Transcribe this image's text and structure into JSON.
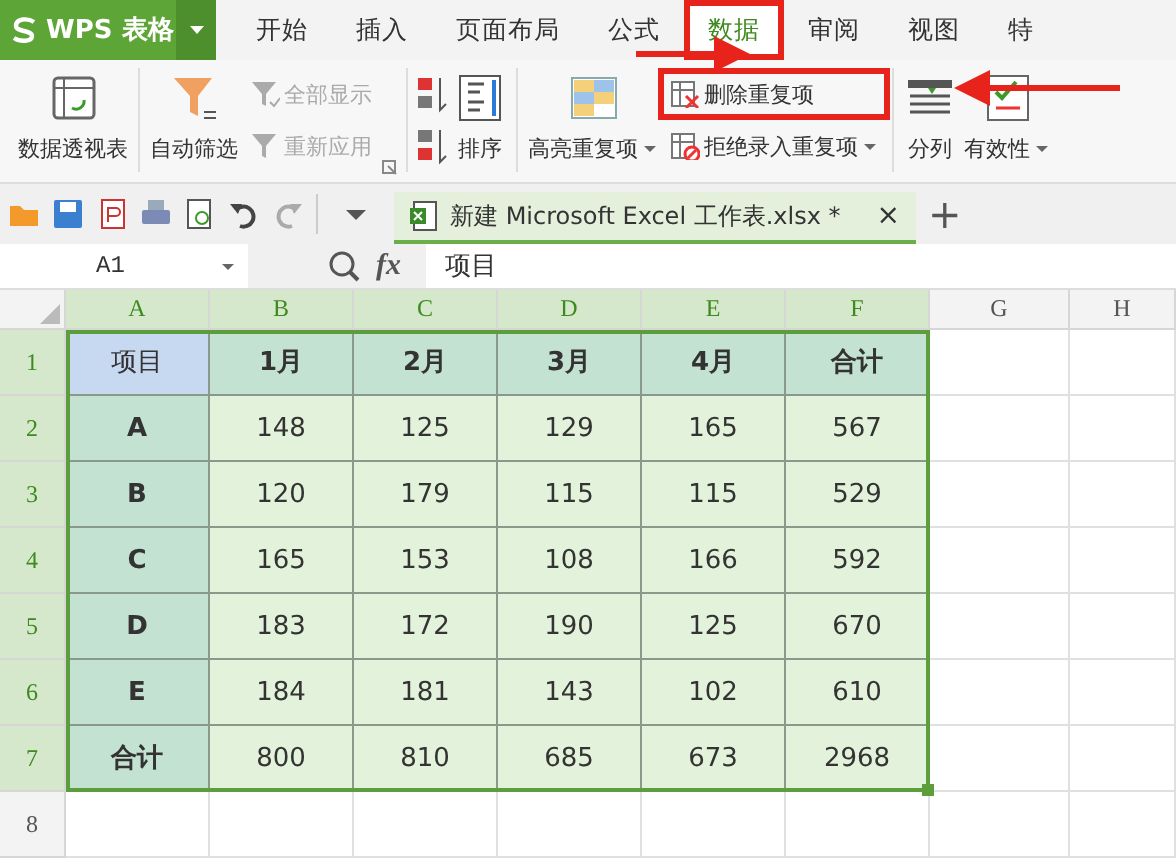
{
  "app_menu": {
    "label": "WPS 表格"
  },
  "tabs": [
    {
      "label": "开始",
      "selected": false,
      "highlighted": false
    },
    {
      "label": "插入",
      "selected": false,
      "highlighted": false
    },
    {
      "label": "页面布局",
      "selected": false,
      "highlighted": false
    },
    {
      "label": "公式",
      "selected": false,
      "highlighted": false
    },
    {
      "label": "数据",
      "selected": true,
      "highlighted": true
    },
    {
      "label": "审阅",
      "selected": false,
      "highlighted": false
    },
    {
      "label": "视图",
      "selected": false,
      "highlighted": false
    },
    {
      "label": "特",
      "selected": false,
      "highlighted": false
    }
  ],
  "ribbon": {
    "groups": [
      [
        {
          "kind": "large",
          "label": "数据透视表",
          "dropdown": false
        }
      ],
      [
        {
          "kind": "large",
          "label": "自动筛选",
          "dropdown": false
        },
        {
          "kind": "stack",
          "items": [
            {
              "label": "全部显示",
              "disabled": true,
              "dropdown": false,
              "highlighted": false
            },
            {
              "label": "重新应用",
              "disabled": true,
              "dropdown": false,
              "highlighted": false
            }
          ]
        },
        {
          "kind": "launcher"
        }
      ],
      [
        {
          "kind": "sort-icons"
        },
        {
          "kind": "large",
          "label": "排序",
          "dropdown": false
        }
      ],
      [
        {
          "kind": "large",
          "label": "高亮重复项",
          "dropdown": true
        },
        {
          "kind": "stack",
          "items": [
            {
              "label": "删除重复项",
              "disabled": false,
              "dropdown": false,
              "highlighted": true
            },
            {
              "label": "拒绝录入重复项",
              "disabled": false,
              "dropdown": true,
              "highlighted": false
            }
          ]
        }
      ],
      [
        {
          "kind": "large",
          "label": "分列",
          "dropdown": false
        },
        {
          "kind": "large",
          "label": "有效性",
          "dropdown": true
        }
      ]
    ]
  },
  "document_tab": {
    "title": "新建 Microsoft Excel 工作表.xlsx *",
    "close": "×",
    "new_tab": "+"
  },
  "formula_bar": {
    "name_box": "A1",
    "fx_label": "fx",
    "formula": "项目"
  },
  "columns": [
    {
      "label": "A",
      "selected": true
    },
    {
      "label": "B",
      "selected": true
    },
    {
      "label": "C",
      "selected": true
    },
    {
      "label": "D",
      "selected": true
    },
    {
      "label": "E",
      "selected": true
    },
    {
      "label": "F",
      "selected": true
    },
    {
      "label": "G",
      "selected": false
    },
    {
      "label": "H",
      "selected": false
    }
  ],
  "rows": [
    {
      "number": "1",
      "selected": true,
      "cells": [
        "项目",
        "1月",
        "2月",
        "3月",
        "4月",
        "合计"
      ]
    },
    {
      "number": "2",
      "selected": true,
      "cells": [
        "A",
        "148",
        "125",
        "129",
        "165",
        "567"
      ]
    },
    {
      "number": "3",
      "selected": true,
      "cells": [
        "B",
        "120",
        "179",
        "115",
        "115",
        "529"
      ]
    },
    {
      "number": "4",
      "selected": true,
      "cells": [
        "C",
        "165",
        "153",
        "108",
        "166",
        "592"
      ]
    },
    {
      "number": "5",
      "selected": true,
      "cells": [
        "D",
        "183",
        "172",
        "190",
        "125",
        "670"
      ]
    },
    {
      "number": "6",
      "selected": true,
      "cells": [
        "E",
        "184",
        "181",
        "143",
        "102",
        "610"
      ]
    },
    {
      "number": "7",
      "selected": true,
      "cells": [
        "合计",
        "800",
        "810",
        "685",
        "673",
        "2968"
      ]
    },
    {
      "number": "8",
      "selected": false,
      "cells": []
    }
  ]
}
